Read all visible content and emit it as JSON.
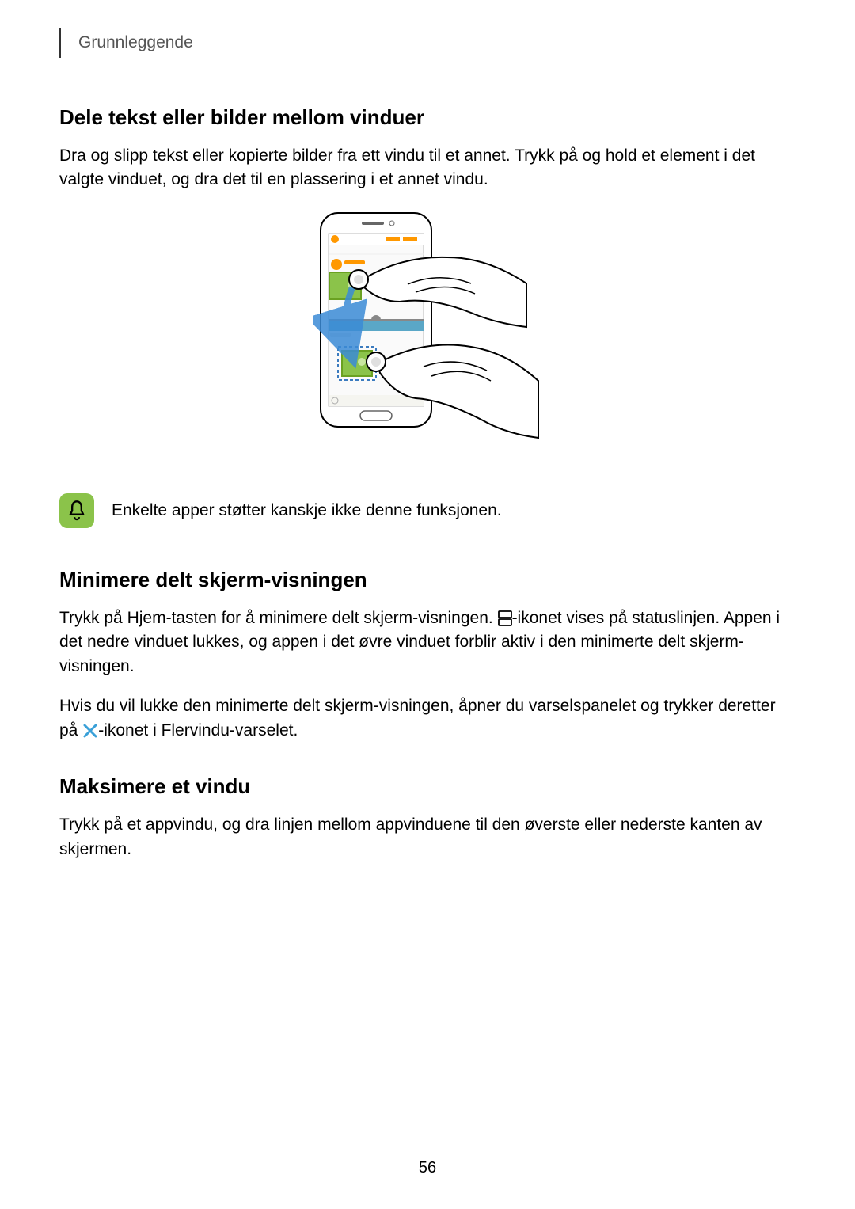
{
  "header": {
    "section": "Grunnleggende"
  },
  "section1": {
    "heading": "Dele tekst eller bilder mellom vinduer",
    "body": "Dra og slipp tekst eller kopierte bilder fra ett vindu til et annet. Trykk på og hold et element i det valgte vinduet, og dra det til en plassering i et annet vindu."
  },
  "note": {
    "text": "Enkelte apper støtter kanskje ikke denne funksjonen."
  },
  "section2": {
    "heading": "Minimere delt skjerm-visningen",
    "p1a": "Trykk på Hjem-tasten for å minimere delt skjerm-visningen. ",
    "p1b": "-ikonet vises på statuslinjen. Appen i det nedre vinduet lukkes, og appen i det øvre vinduet forblir aktiv i den minimerte delt skjerm-visningen.",
    "p2a": "Hvis du vil lukke den minimerte delt skjerm-visningen, åpner du varselspanelet og trykker deretter på ",
    "p2b": "-ikonet i Flervindu-varselet."
  },
  "section3": {
    "heading": "Maksimere et vindu",
    "body": "Trykk på et appvindu, og dra linjen mellom appvinduene til den øverste eller nederste kanten av skjermen."
  },
  "pageNumber": "56"
}
